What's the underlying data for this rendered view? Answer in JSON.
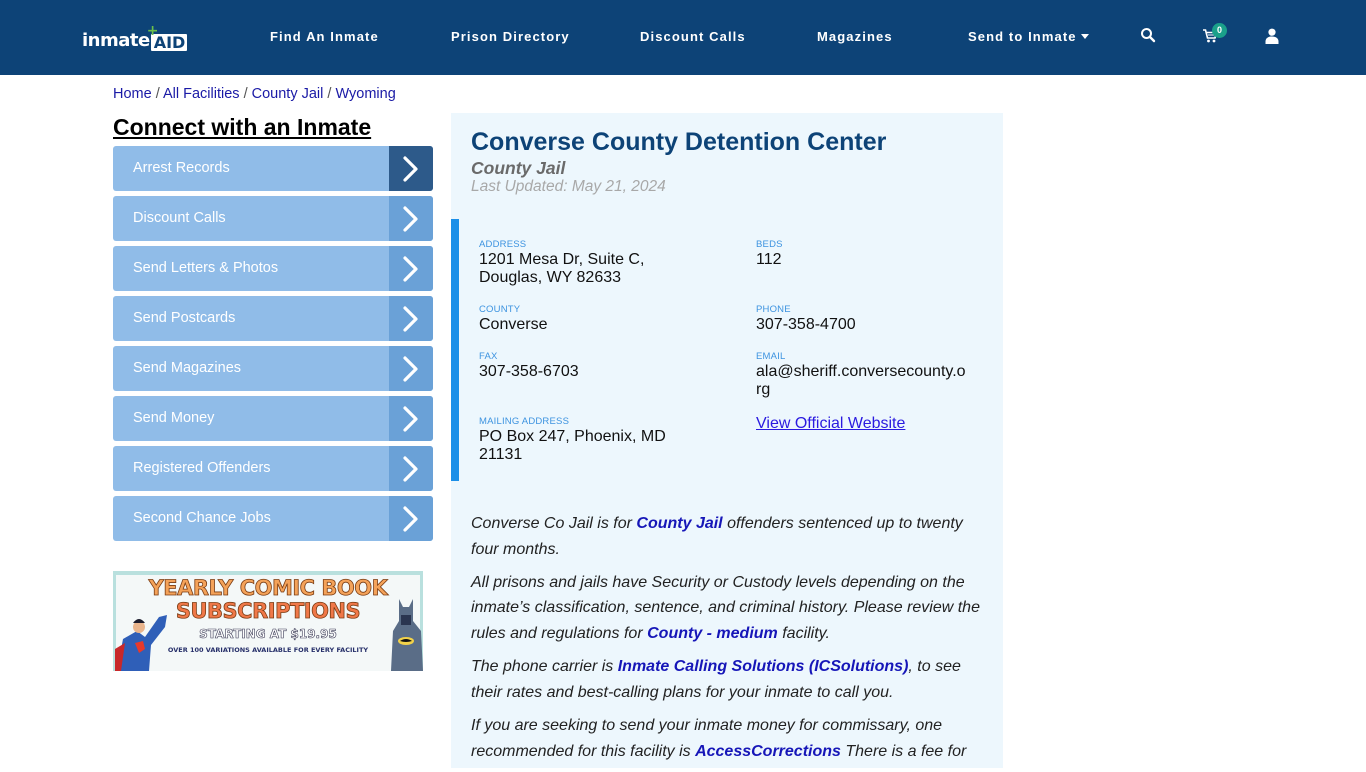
{
  "header": {
    "logo": {
      "part1": "inmate",
      "part2": "AID",
      "plus": "+"
    },
    "nav": [
      {
        "label": "Find An Inmate"
      },
      {
        "label": "Prison Directory"
      },
      {
        "label": "Discount Calls"
      },
      {
        "label": "Magazines"
      },
      {
        "label": "Send to Inmate",
        "has_dropdown": true
      }
    ],
    "icons": [
      "search-icon",
      "cart-icon",
      "user-icon"
    ],
    "cart_count": "0",
    "colors": {
      "bar": "#0d4377",
      "badge": "#1aa08a"
    }
  },
  "breadcrumb": {
    "items": [
      "Home",
      "All Facilities",
      "County Jail",
      "Wyoming"
    ],
    "separator": "/"
  },
  "sidebar": {
    "title": "Connect with an Inmate",
    "items": [
      {
        "label": "Arrest Records",
        "active": true
      },
      {
        "label": "Discount Calls"
      },
      {
        "label": "Send Letters & Photos"
      },
      {
        "label": "Send Postcards"
      },
      {
        "label": "Send Magazines"
      },
      {
        "label": "Send Money"
      },
      {
        "label": "Registered Offenders"
      },
      {
        "label": "Second Chance Jobs"
      }
    ],
    "ad": {
      "line1": "YEARLY COMIC BOOK",
      "line2": "SUBSCRIPTIONS",
      "line3": "STARTING AT $19.95",
      "line4": "OVER 100 VARIATIONS AVAILABLE FOR EVERY FACILITY"
    }
  },
  "facility": {
    "name": "Converse County Detention Center",
    "type": "County Jail",
    "last_updated": "Last Updated: May 21, 2024",
    "fields": {
      "address": {
        "label": "ADDRESS",
        "line1": "1201 Mesa Dr, Suite C,",
        "line2": "Douglas, WY 82633"
      },
      "beds": {
        "label": "BEDS",
        "value": "112"
      },
      "county": {
        "label": "COUNTY",
        "value": "Converse"
      },
      "phone": {
        "label": "PHONE",
        "value": "307-358-4700"
      },
      "fax": {
        "label": "FAX",
        "value": "307-358-6703"
      },
      "email": {
        "label": "EMAIL",
        "line1": "ala@sheriff.conversecounty.o",
        "line2": "rg"
      },
      "mailing": {
        "label": "MAILING ADDRESS",
        "line1": "PO Box 247, Phoenix, MD",
        "line2": "21131"
      },
      "website": {
        "label": "View Official Website"
      }
    },
    "paragraphs": {
      "p1": {
        "pre": "Converse Co Jail is for ",
        "link": "County Jail",
        "post": " offenders sentenced up to twenty four months."
      },
      "p2": {
        "pre": "All prisons and jails have Security or Custody levels depending on the inmate’s classification, sentence, and criminal history. Please review the rules and regulations for ",
        "link": "County - medium",
        "post": " facility."
      },
      "p3": {
        "pre": "The phone carrier is ",
        "link": "Inmate Calling Solutions (ICSolutions)",
        "post": ", to see their rates and best-calling plans for your inmate to call you."
      },
      "p4": {
        "pre": "If you are seeking to send your inmate money for commissary, one recommended for this facility is ",
        "link": "AccessCorrections",
        "post": " There is a fee for"
      }
    }
  }
}
